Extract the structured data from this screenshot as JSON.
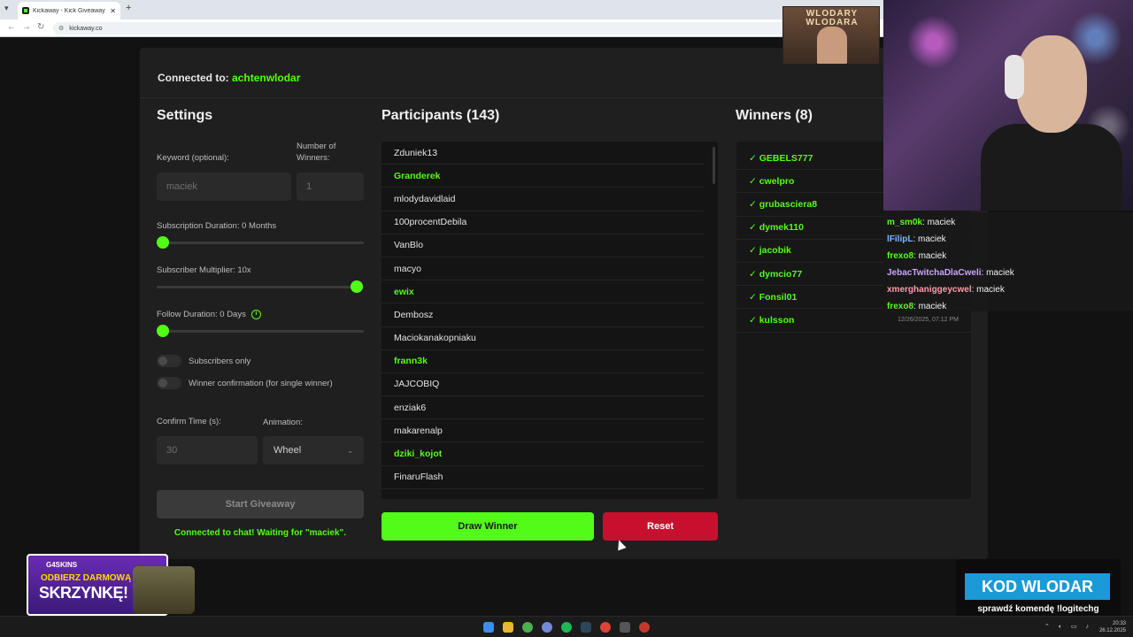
{
  "browser": {
    "tab_title": "Kickaway - Kick Giveaway Tool",
    "tab_close": "✕",
    "new_tab": "+",
    "url": "kickaway.co",
    "nav_back": "←",
    "nav_forward": "→",
    "nav_reload": "↻"
  },
  "header": {
    "connected_prefix": "Connected to:",
    "connected_user": "achtenwlodar"
  },
  "settings": {
    "title": "Settings",
    "keyword_label": "Keyword (optional):",
    "keyword_value": "maciek",
    "winners_label": "Number of Winners:",
    "winners_value": "1",
    "sub_duration_label": "Subscription Duration: 0 Months",
    "sub_duration_value": 0,
    "multiplier_label": "Subscriber Multiplier: 10x",
    "multiplier_value": 10,
    "follow_label": "Follow Duration: 0 Days",
    "follow_value": 0,
    "subscribers_only_label": "Subscribers only",
    "subscribers_only": false,
    "winner_confirm_label": "Winner confirmation (for single winner)",
    "winner_confirm": false,
    "confirm_time_label": "Confirm Time (s):",
    "confirm_time_value": "30",
    "animation_label": "Animation:",
    "animation_value": "Wheel",
    "start_button": "Start Giveaway",
    "status": "Connected to chat! Waiting for \"maciek\"."
  },
  "participants": {
    "title": "Participants (143)",
    "items": [
      {
        "name": "Zduniek13",
        "subscriber": false
      },
      {
        "name": "Granderek",
        "subscriber": true
      },
      {
        "name": "mlodydavidlaid",
        "subscriber": false
      },
      {
        "name": "100procentDebila",
        "subscriber": false
      },
      {
        "name": "VanBlo",
        "subscriber": false
      },
      {
        "name": "macyo",
        "subscriber": false
      },
      {
        "name": "ewix",
        "subscriber": true
      },
      {
        "name": "Dembosz",
        "subscriber": false
      },
      {
        "name": "Maciokanakopniaku",
        "subscriber": false
      },
      {
        "name": "frann3k",
        "subscriber": true
      },
      {
        "name": "JAJCOBIQ",
        "subscriber": false
      },
      {
        "name": "enziak6",
        "subscriber": false
      },
      {
        "name": "makarenalp",
        "subscriber": false
      },
      {
        "name": "dziki_kojot",
        "subscriber": true
      },
      {
        "name": "FinaruFlash",
        "subscriber": false
      }
    ],
    "draw_button": "Draw Winner",
    "reset_button": "Reset"
  },
  "winners": {
    "title": "Winners (8)",
    "items": [
      {
        "name": "✓ GEBELS777",
        "time": ""
      },
      {
        "name": "✓ cwelpro",
        "time": ""
      },
      {
        "name": "✓ grubasciera8",
        "time": ""
      },
      {
        "name": "✓ dymek110",
        "time": ""
      },
      {
        "name": "✓ jacobik",
        "time": ""
      },
      {
        "name": "✓ dymcio77",
        "time": ""
      },
      {
        "name": "✓ Fonsil01",
        "time": ""
      },
      {
        "name": "✓ kulsson",
        "time": "12/26/2025, 07:12 PM"
      }
    ]
  },
  "stream": {
    "logo_text": "WLODARY WLODARA",
    "chat": [
      {
        "user": "m_sm0k",
        "color": "#53fc18",
        "text": ": maciek"
      },
      {
        "user": "lFilipL",
        "color": "#7ab8ff",
        "text": ": maciek"
      },
      {
        "user": "frexo8",
        "color": "#53fc18",
        "text": ": maciek"
      },
      {
        "user": "JebacTwitchaDlaCweli",
        "color": "#c9a6ff",
        "text": ": maciek"
      },
      {
        "user": "xmerghaniggeycwel",
        "color": "#ff9aa8",
        "text": ": maciek"
      },
      {
        "user": "frexo8",
        "color": "#53fc18",
        "text": ": maciek"
      }
    ],
    "promo_brand": "G4SKINS",
    "promo_line1": "ODBIERZ DARMOWĄ",
    "promo_line2": "SKRZYNKĘ!",
    "code_title": "KOD WLODAR",
    "code_subtitle": "sprawdź komendę !logitechg"
  },
  "taskbar": {
    "time": "20:33",
    "date": "26.12.2025"
  },
  "colors": {
    "accent": "#53fc18",
    "danger": "#c8102e",
    "background": "#121212",
    "card": "#1f1f1f"
  }
}
